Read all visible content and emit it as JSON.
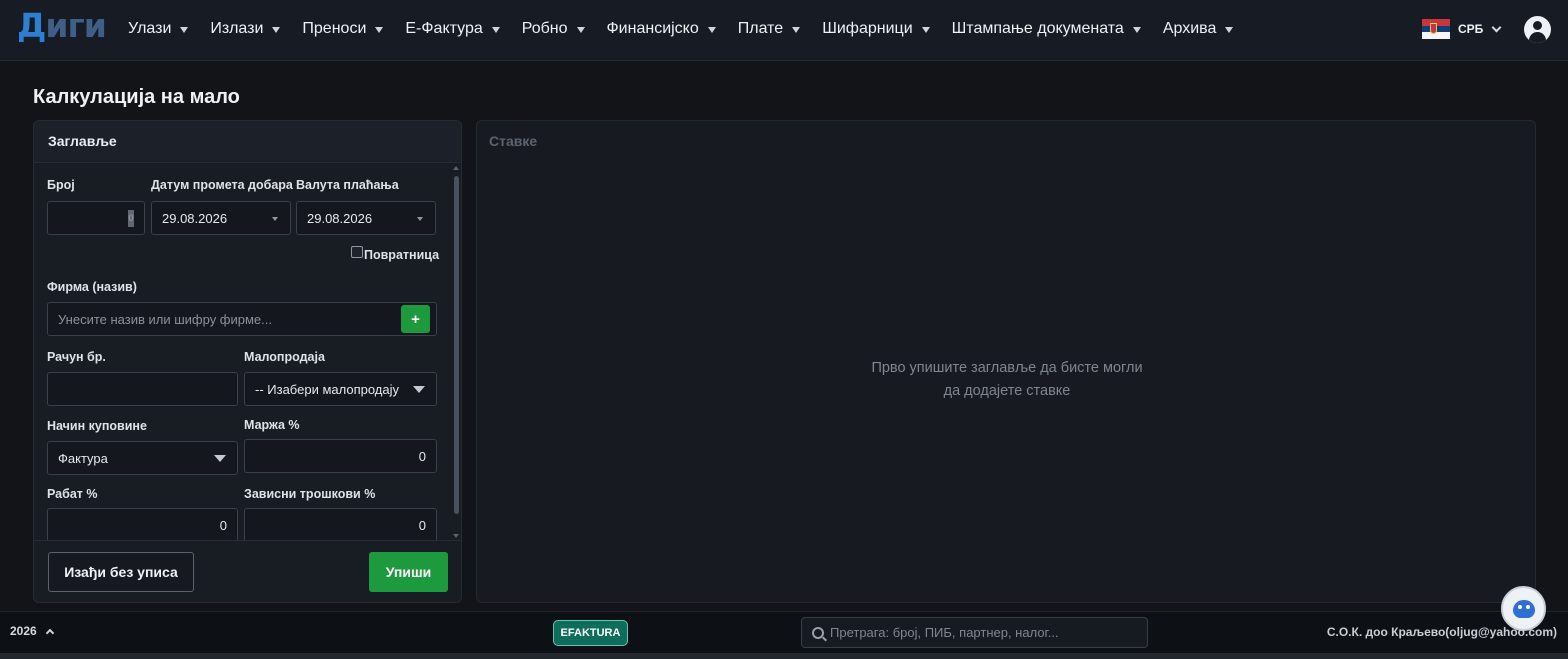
{
  "app": {
    "logo_part1": "Д",
    "logo_part2": "иги"
  },
  "nav": {
    "items": [
      {
        "label": "Улази"
      },
      {
        "label": "Излази"
      },
      {
        "label": "Преноси"
      },
      {
        "label": "Е-Фактура"
      },
      {
        "label": "Робно"
      },
      {
        "label": "Финансијско"
      },
      {
        "label": "Плате"
      },
      {
        "label": "Шифарници"
      },
      {
        "label": "Штампање докумената"
      },
      {
        "label": "Архива"
      }
    ],
    "language": "СРБ"
  },
  "page": {
    "title": "Калкулација на мало"
  },
  "header_panel": {
    "title": "Заглавље",
    "broj": {
      "label": "Број",
      "value": "",
      "cursor_char": "0"
    },
    "datum_prometa": {
      "label": "Датум промета добара",
      "value": "29.08.2026"
    },
    "valuta_placanja": {
      "label": "Валута плаћања",
      "value": "29.08.2026"
    },
    "povratnica": {
      "label": "Повратница",
      "checked": false
    },
    "firma": {
      "label": "Фирма (назив)",
      "placeholder": "Унесите назив или шифру фирме...",
      "add_label": "+"
    },
    "racun_br": {
      "label": "Рачун бр.",
      "value": ""
    },
    "maloprodaja": {
      "label": "Малопродаја",
      "value": "-- Изабери малопродају"
    },
    "nacin_kupovine": {
      "label": "Начин куповине",
      "value": "Фактура"
    },
    "marza": {
      "label": "Маржа %",
      "value": "0"
    },
    "rabat": {
      "label": "Рабат %",
      "value": "0"
    },
    "zavisni_troskovi": {
      "label": "Зависни трошкови %",
      "value": "0"
    },
    "cancel_label": "Изађи без уписа",
    "save_label": "Упиши"
  },
  "items_panel": {
    "title": "Ставке",
    "empty_line1": "Прво упишите заглавље да бисте могли",
    "empty_line2": "да додајете ставке"
  },
  "footer": {
    "year": "2026",
    "efaktura_label": "EFAKTURA",
    "search_placeholder": "Претрага: број, ПИБ, партнер, налог...",
    "company": "С.О.К. доо Краљево(oljug@yahoo.com)"
  }
}
